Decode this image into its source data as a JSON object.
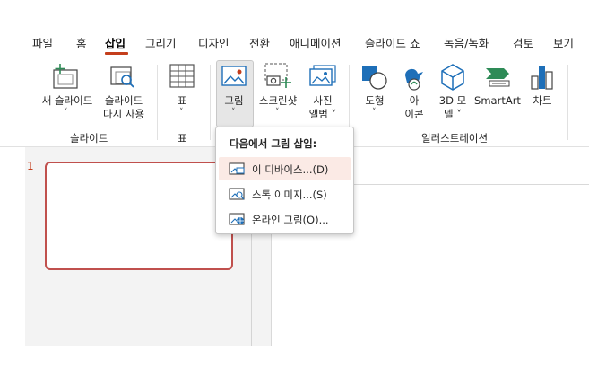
{
  "tabs": [
    {
      "label": "파일"
    },
    {
      "label": "홈"
    },
    {
      "label": "삽입",
      "active": true
    },
    {
      "label": "그리기"
    },
    {
      "label": "디자인"
    },
    {
      "label": "전환"
    },
    {
      "label": "애니메이션"
    },
    {
      "label": "슬라이드 쇼"
    },
    {
      "label": "녹음/녹화"
    },
    {
      "label": "검토"
    },
    {
      "label": "보기"
    }
  ],
  "ribbon": {
    "new_slide": {
      "line1": "새 슬라이드",
      "chevron": "˅"
    },
    "reuse_slide": {
      "line1": "슬라이드",
      "line2": "다시 사용"
    },
    "table": {
      "line1": "표",
      "chevron": "˅"
    },
    "pictures": {
      "line1": "그림",
      "chevron": "˅"
    },
    "screenshot": {
      "line1": "스크린샷",
      "chevron": "˅"
    },
    "photo_album": {
      "line1": "사진",
      "line2": "앨범 ˅"
    },
    "shapes": {
      "line1": "도형",
      "chevron": "˅"
    },
    "icons": {
      "line1": "아",
      "line2": "이콘"
    },
    "models_3d": {
      "line1": "3D 모",
      "line2": "델 ˅"
    },
    "smartart": {
      "line1": "SmartArt"
    },
    "chart": {
      "line1": "차트"
    },
    "groups": {
      "slides": "슬라이드",
      "table": "표",
      "illustrations": "일러스트레이션"
    }
  },
  "slide_panel": {
    "slide_number": "1"
  },
  "dropdown": {
    "title": "다음에서 그림 삽입:",
    "items": [
      {
        "label": "이 디바이스...(D)",
        "icon": "device-picture-icon"
      },
      {
        "label": "스톡 이미지...(S)",
        "icon": "stock-images-icon"
      },
      {
        "label": "온라인 그림(O)...",
        "icon": "online-pictures-icon"
      }
    ]
  },
  "colors": {
    "accent": "#c43e1c",
    "slide_border": "#c0504d",
    "icon_blue": "#1e6fb8",
    "icon_green": "#2e8b57"
  }
}
